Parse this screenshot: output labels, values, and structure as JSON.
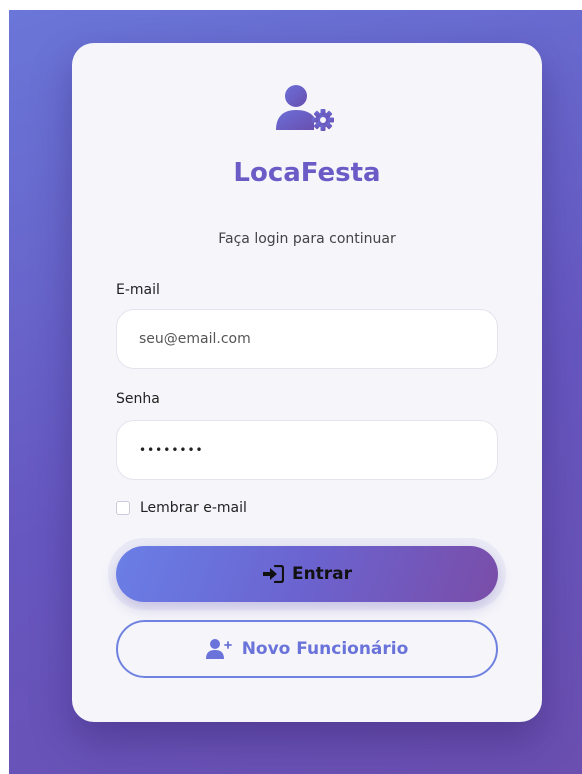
{
  "app": {
    "title": "LocaFesta",
    "subtitle": "Faça login para continuar"
  },
  "form": {
    "email_label": "E-mail",
    "email_placeholder": "seu@email.com",
    "password_label": "Senha",
    "password_value": "••••••••",
    "remember_label": "Lembrar e-mail",
    "remember_checked": false
  },
  "buttons": {
    "login_label": "Entrar",
    "new_employee_label": "Novo Funcionário"
  },
  "icons": {
    "logo": "user-gear-icon",
    "login": "sign-in-icon",
    "new_employee": "user-plus-icon"
  },
  "colors": {
    "accent": "#6a5bc6",
    "background_gradient_start": "#6a76d8",
    "background_gradient_end": "#6a4fb0",
    "card": "#f5f5fa"
  }
}
